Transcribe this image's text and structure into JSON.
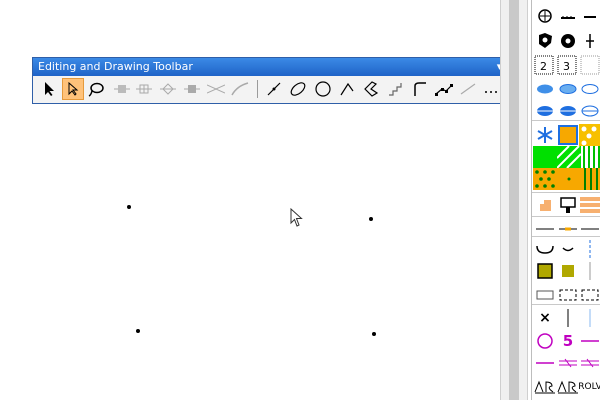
{
  "toolbar": {
    "title": "Editing and Drawing Toolbar",
    "dropdown_symbol": "▾",
    "close_symbol": "✕",
    "tools": [
      "select-arrow-icon",
      "select-vertex-icon",
      "lasso-icon",
      "node-icon",
      "node-split-icon",
      "node-diamond-icon",
      "node-square-icon",
      "split-lines-icon",
      "curve-edit-icon",
      "line-icon",
      "ellipse-icon",
      "circle-icon",
      "polyline-icon",
      "polygon-icon",
      "stair-line-icon",
      "curve-line-icon",
      "spline-icon",
      "dotted-line-icon",
      "dashed-segment-icon",
      "diagonal-line-icon"
    ]
  },
  "canvas": {
    "dots": [
      "point-1",
      "point-2",
      "point-3",
      "point-4"
    ],
    "cursor": "mouse-cursor"
  },
  "palette": {
    "labels": {
      "five": "5",
      "rolv": "ROLV",
      "x": "×"
    },
    "colors": {
      "green": "#00e000",
      "orange": "#f7a800",
      "blue": "#1f6fe0",
      "purple": "#c000c0",
      "olive": "#b0a800"
    }
  }
}
